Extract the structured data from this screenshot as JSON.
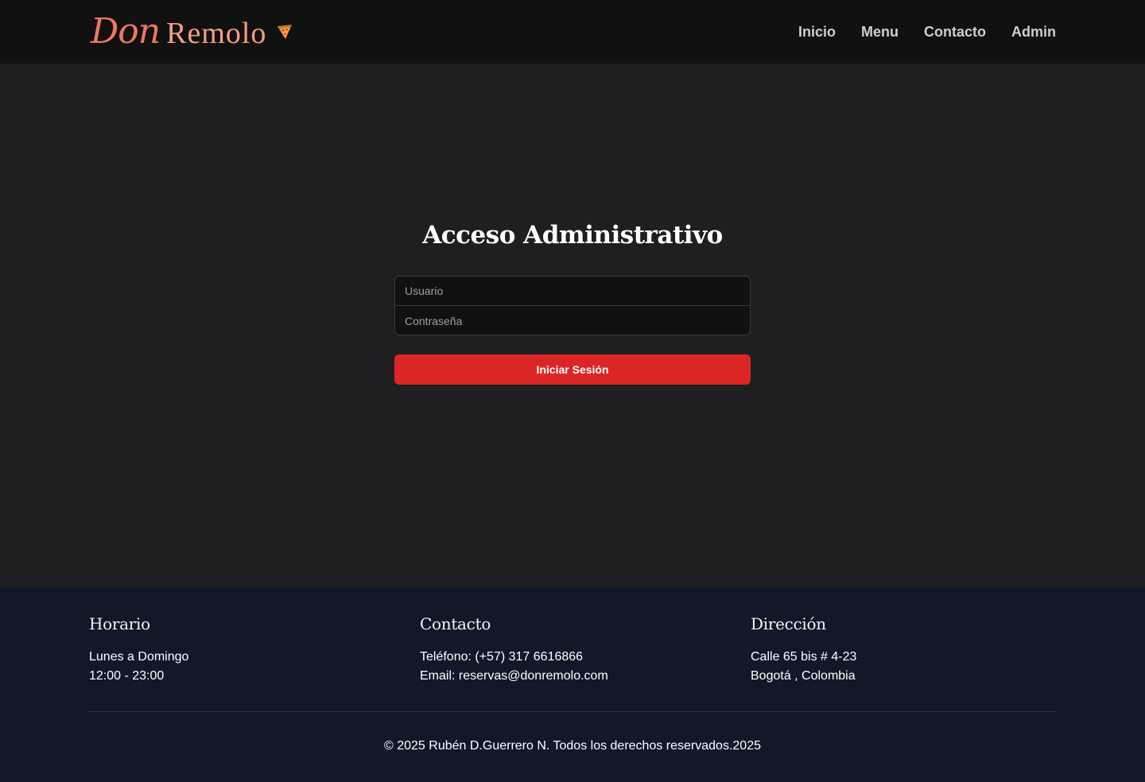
{
  "brand": {
    "name_part1": "Don",
    "name_part2": "Remolo",
    "icon": "pizza-icon",
    "color_primary": "#ef7663"
  },
  "nav": {
    "items": [
      {
        "label": "Inicio"
      },
      {
        "label": "Menu"
      },
      {
        "label": "Contacto"
      },
      {
        "label": "Admin"
      }
    ]
  },
  "login": {
    "title": "Acceso Administrativo",
    "username_placeholder": "Usuario",
    "password_placeholder": "Contraseña",
    "submit_label": "Iniciar Sesión",
    "button_color": "#dc2626"
  },
  "footer": {
    "horario": {
      "title": "Horario",
      "line1": "Lunes a Domingo",
      "line2": "12:00 - 23:00"
    },
    "contacto": {
      "title": "Contacto",
      "line1": "Teléfono: (+57) 317 6616866",
      "line2": "Email: reservas@donremolo.com"
    },
    "direccion": {
      "title": "Dirección",
      "line1": "Calle 65 bis # 4-23",
      "line2": "Bogotá , Colombia"
    },
    "copyright": "© 2025 Rubén D.Guerrero N. Todos los derechos reservados.2025"
  }
}
